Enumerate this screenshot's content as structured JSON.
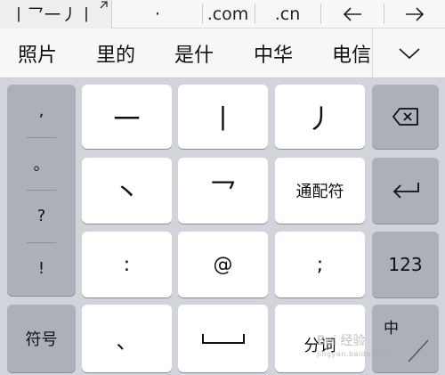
{
  "shortcut_bar": {
    "composition": "丨乛一丿丨",
    "items": [
      "·",
      ".com",
      ".cn"
    ],
    "cursor_left": "←",
    "cursor_right": "→"
  },
  "candidates": {
    "items": [
      "照片",
      "里的",
      "是什",
      "中华",
      "电信"
    ],
    "more": "chevron-down"
  },
  "punctuation": [
    ",",
    "。",
    "?",
    "!"
  ],
  "keys": {
    "row1": [
      "一",
      "丨",
      "丿"
    ],
    "row2": [
      "丶",
      "乛",
      "通配符"
    ],
    "row3": [
      ":",
      "@",
      ";"
    ],
    "symbols": "符号",
    "dun": "、",
    "space": "space",
    "fenci": "分词",
    "numbers": "123",
    "lang": "中"
  },
  "watermark": {
    "text": "Bai 经验",
    "sub": "jingyan.baidu.com"
  }
}
